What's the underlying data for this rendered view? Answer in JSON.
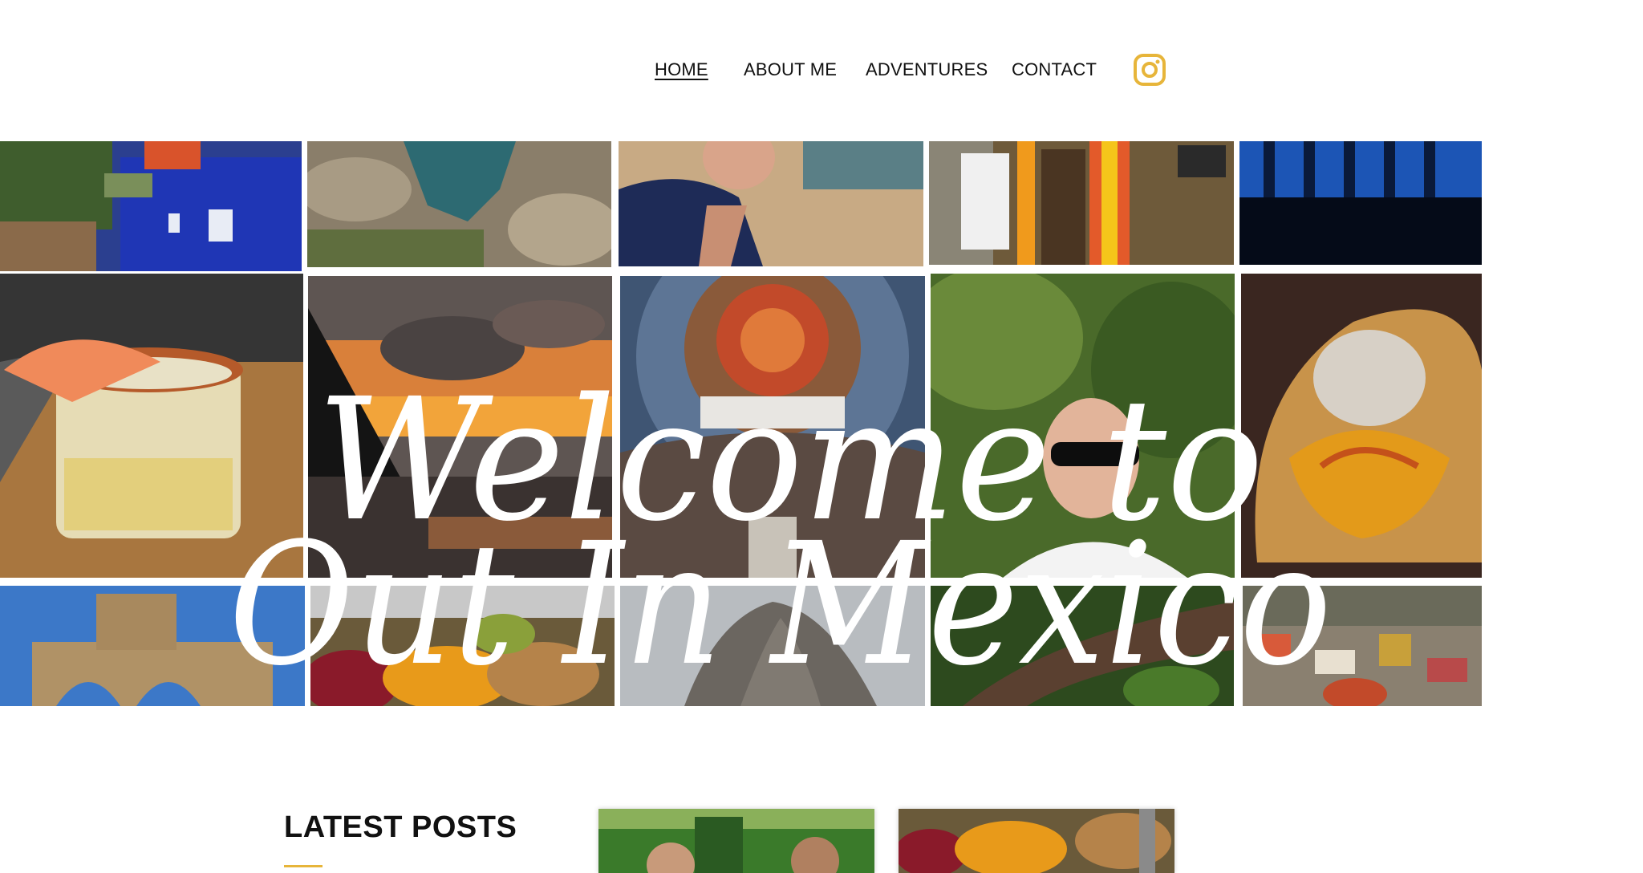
{
  "nav": {
    "items": [
      {
        "label": "HOME",
        "active": true
      },
      {
        "label": "ABOUT ME",
        "active": false
      },
      {
        "label": "ADVENTURES",
        "active": false
      },
      {
        "label": "CONTACT",
        "active": false
      }
    ],
    "social_icon": "instagram-icon",
    "accent_color": "#e7b53a"
  },
  "hero": {
    "line1": "Welcome to",
    "line2": "Out In Mexico"
  },
  "latest": {
    "title": "LATEST POSTS"
  }
}
